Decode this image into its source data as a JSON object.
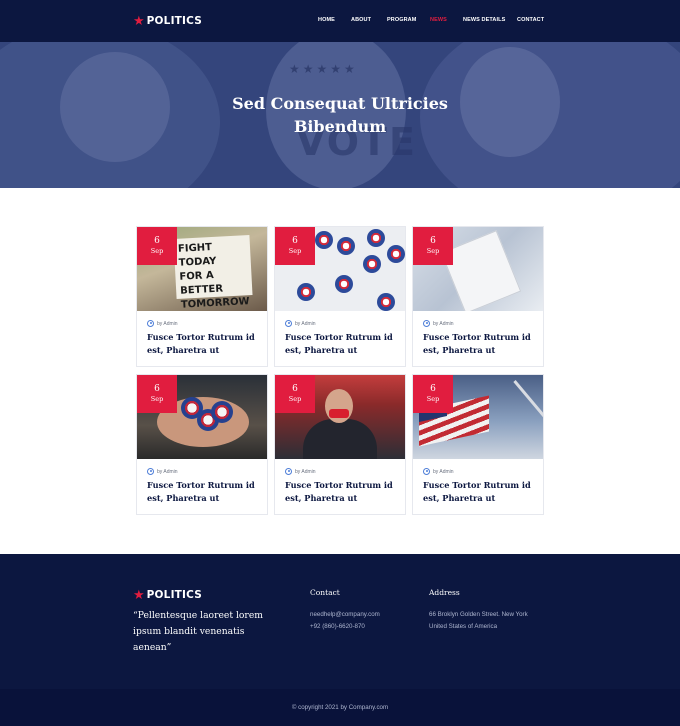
{
  "header": {
    "logo": "POLITICS",
    "nav": [
      {
        "label": "HOME"
      },
      {
        "label": "ABOUT"
      },
      {
        "label": "PROGRAM"
      },
      {
        "label": "NEWS",
        "active": true
      },
      {
        "label": "NEWS DETAILS"
      },
      {
        "label": "CONTACT"
      }
    ]
  },
  "hero": {
    "title_line1": "Sed Consequat Ultricies",
    "title_line2": "Bibendum",
    "badge_text": "VOTE"
  },
  "cards": [
    {
      "day": "6",
      "month": "Sep",
      "author": "by Admin",
      "title": "Fusce Tortor Rutrum id est, Pharetra ut",
      "image": "protest-sign-image"
    },
    {
      "day": "6",
      "month": "Sep",
      "author": "by Admin",
      "title": "Fusce Tortor Rutrum id est, Pharetra ut",
      "image": "vote-pins-image"
    },
    {
      "day": "6",
      "month": "Sep",
      "author": "by Admin",
      "title": "Fusce Tortor Rutrum id est, Pharetra ut",
      "image": "newspaper-image"
    },
    {
      "day": "6",
      "month": "Sep",
      "author": "by Admin",
      "title": "Fusce Tortor Rutrum id est, Pharetra ut",
      "image": "hand-badges-image"
    },
    {
      "day": "6",
      "month": "Sep",
      "author": "by Admin",
      "title": "Fusce Tortor Rutrum id est, Pharetra ut",
      "image": "protester-image"
    },
    {
      "day": "6",
      "month": "Sep",
      "author": "by Admin",
      "title": "Fusce Tortor Rutrum id est, Pharetra ut",
      "image": "flag-image"
    }
  ],
  "sign_text": [
    "FIGHT TODAY",
    "FOR A BETTER",
    "TOMORROW"
  ],
  "footer": {
    "logo": "POLITICS",
    "quote": "“Pellentesque laoreet lorem ipsum blandit venenatis aenean”",
    "contact_heading": "Contact",
    "email": "needhelp@company.com",
    "phone": "+92 (860)-6620-870",
    "address_heading": "Address",
    "address_line1": "66 Broklyn Golden Street. New York",
    "address_line2": "United States of America",
    "copyright": "© copyright 2021 by Company.com"
  },
  "colors": {
    "navy": "#0c1740",
    "accent": "#e11d3f",
    "hero_overlay": "#34457c"
  }
}
